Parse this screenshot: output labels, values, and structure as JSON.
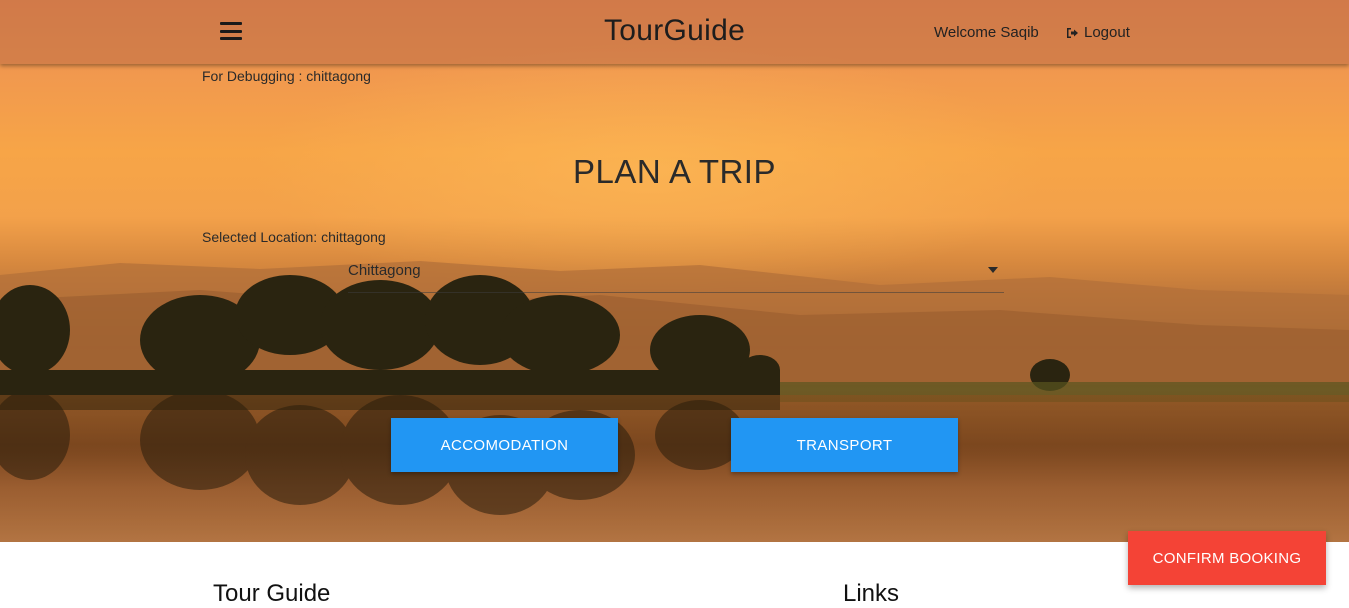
{
  "navbar": {
    "brand": "TourGuide",
    "menu_icon": "hamburger-menu-icon",
    "welcome": "Welcome Saqib",
    "logout_label": "Logout",
    "logout_icon": "sign-out-icon"
  },
  "debug_text": "For Debugging : chittagong",
  "main": {
    "title": "PLAN A TRIP",
    "selected_location": "Selected Location: chittagong",
    "location_select": {
      "value": "Chittagong",
      "caret_icon": "caret-down-icon"
    },
    "buttons": {
      "accomodation": "ACCOMODATION",
      "transport": "TRANSPORT"
    }
  },
  "confirm_booking": "CONFIRM BOOKING",
  "footer": {
    "tour_guide_heading": "Tour Guide",
    "links_heading": "Links"
  },
  "colors": {
    "primary_button": "#2196f3",
    "confirm_button": "#f44336",
    "navbar_overlay": "#be6e46"
  }
}
